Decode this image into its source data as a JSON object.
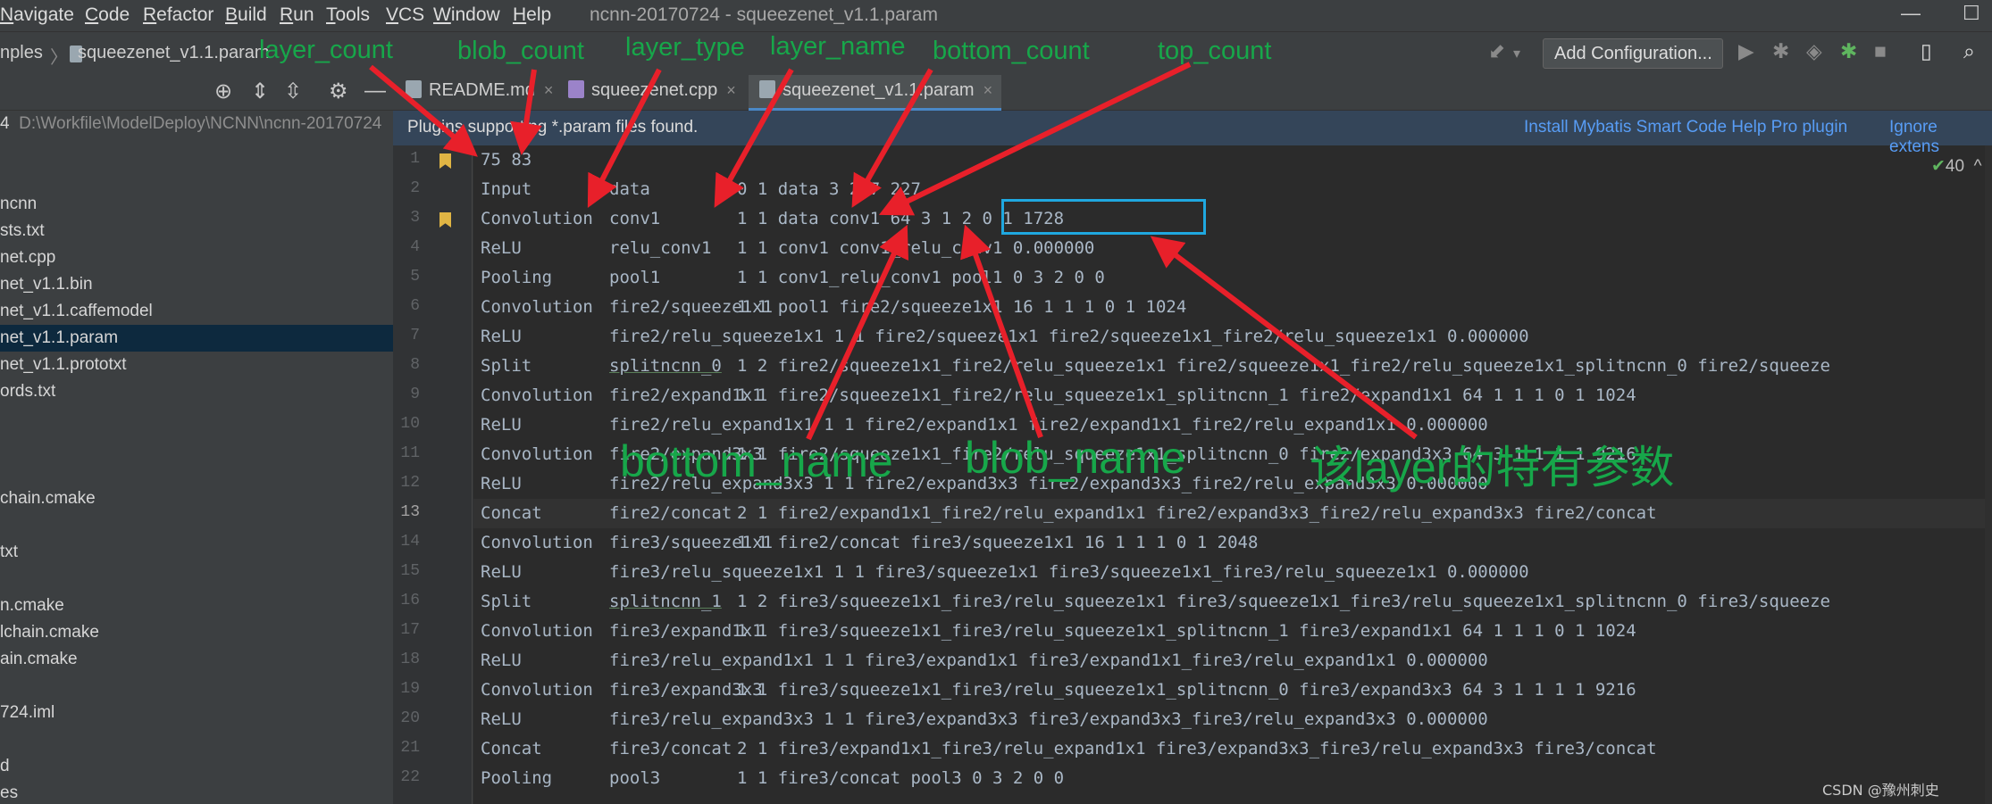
{
  "menu": {
    "items": [
      {
        "label": "Navigate",
        "mn": "N",
        "rest": "avigate"
      },
      {
        "label": "Code",
        "mn": "C",
        "rest": "ode"
      },
      {
        "label": "Refactor",
        "mn": "R",
        "rest": "efactor"
      },
      {
        "label": "Build",
        "mn": "B",
        "rest": "uild"
      },
      {
        "label": "Run",
        "mn": "R",
        "rest": "un"
      },
      {
        "label": "Tools",
        "mn": "T",
        "rest": "ools"
      },
      {
        "label": "VCS",
        "mn": "V",
        "rest": "CS"
      },
      {
        "label": "Window",
        "mn": "W",
        "rest": "indow"
      },
      {
        "label": "Help",
        "mn": "H",
        "rest": "elp"
      }
    ],
    "window_title": "ncnn-20170724 - squeezenet_v1.1.param",
    "minimize": "—",
    "maximize": "☐"
  },
  "toolbar": {
    "crumb_parent": "nples",
    "crumb_sep": "〉",
    "crumb_file": "squeezenet_v1.1.param",
    "add_config": "Add Configuration..."
  },
  "tabs": [
    {
      "label": "README.md",
      "close": "×"
    },
    {
      "label": "squeezenet.cpp",
      "close": "×"
    },
    {
      "label": "squeezenet_v1.1.param",
      "close": "×"
    }
  ],
  "sidebar": {
    "project_num": "4",
    "project_path": "D:\\Workfile\\ModelDeploy\\NCNN\\ncnn-20170724",
    "items": [
      {
        "label": "ncnn"
      },
      {
        "label": "sts.txt"
      },
      {
        "label": "net.cpp"
      },
      {
        "label": "net_v1.1.bin"
      },
      {
        "label": "net_v1.1.caffemodel"
      },
      {
        "label": "net_v1.1.param"
      },
      {
        "label": "net_v1.1.prototxt"
      },
      {
        "label": "ords.txt"
      },
      {
        "label": "chain.cmake"
      },
      {
        "label": "txt"
      },
      {
        "label": "n.cmake"
      },
      {
        "label": "lchain.cmake"
      },
      {
        "label": "ain.cmake"
      },
      {
        "label": "724.iml"
      },
      {
        "label": "d"
      },
      {
        "label": "es"
      }
    ]
  },
  "banner": {
    "message": "Plugins supporting *.param files found.",
    "install": "Install Mybatis Smart Code Help Pro plugin",
    "ignore": "Ignore extens"
  },
  "inspection": {
    "check": "✔",
    "count": "40",
    "caret": "^"
  },
  "code_lines": [
    {
      "n": "1",
      "type": "75 83",
      "name": "",
      "rest": ""
    },
    {
      "n": "2",
      "type": "Input",
      "name": "data",
      "rest": "0 1 data 3 227 227"
    },
    {
      "n": "3",
      "type": "Convolution",
      "name": "conv1",
      "rest": "1 1 data conv1 64 3 1 2 0 1 1728"
    },
    {
      "n": "4",
      "type": "ReLU",
      "name": "relu_conv1",
      "rest": "1 1 conv1 conv1_relu_conv1 0.000000"
    },
    {
      "n": "5",
      "type": "Pooling",
      "name": "pool1",
      "rest": "1 1 conv1_relu_conv1 pool1 0 3 2 0 0"
    },
    {
      "n": "6",
      "type": "Convolution",
      "name": "fire2/squeeze1x1",
      "rest": "1 1 pool1 fire2/squeeze1x1 16 1 1 1 0 1 1024"
    },
    {
      "n": "7",
      "type": "ReLU",
      "name": "fire2/relu_squeeze1x1 1 1 fire2/squeeze1x1 fire2/squeeze1x1_fire2/relu_squeeze1x1 0.000000",
      "rest": ""
    },
    {
      "n": "8",
      "type": "Split",
      "name": "splitncnn_0",
      "rest": "1 2 fire2/squeeze1x1_fire2/relu_squeeze1x1 fire2/squeeze1x1_fire2/relu_squeeze1x1_splitncnn_0 fire2/squeeze"
    },
    {
      "n": "9",
      "type": "Convolution",
      "name": "fire2/expand1x1",
      "rest": "1 1 fire2/squeeze1x1_fire2/relu_squeeze1x1_splitncnn_1 fire2/expand1x1 64 1 1 1 0 1 1024"
    },
    {
      "n": "10",
      "type": "ReLU",
      "name": "fire2/relu_expand1x1 1 1 fire2/expand1x1 fire2/expand1x1_fire2/relu_expand1x1 0.000000",
      "rest": ""
    },
    {
      "n": "11",
      "type": "Convolution",
      "name": "fire2/expand3x3",
      "rest": "1 1 fire2/squeeze1x1_fire2/relu_squeeze1x1_splitncnn_0 fire2/expand3x3 64 3 1 1 1 1 9216"
    },
    {
      "n": "12",
      "type": "ReLU",
      "name": "fire2/relu_expand3x3 1 1 fire2/expand3x3 fire2/expand3x3_fire2/relu_expand3x3 0.000000",
      "rest": ""
    },
    {
      "n": "13",
      "type": "Concat",
      "name": "fire2/concat",
      "rest": "2 1 fire2/expand1x1_fire2/relu_expand1x1 fire2/expand3x3_fire2/relu_expand3x3 fire2/concat"
    },
    {
      "n": "14",
      "type": "Convolution",
      "name": "fire3/squeeze1x1",
      "rest": "1 1 fire2/concat fire3/squeeze1x1 16 1 1 1 0 1 2048"
    },
    {
      "n": "15",
      "type": "ReLU",
      "name": "fire3/relu_squeeze1x1 1 1 fire3/squeeze1x1 fire3/squeeze1x1_fire3/relu_squeeze1x1 0.000000",
      "rest": ""
    },
    {
      "n": "16",
      "type": "Split",
      "name": "splitncnn_1",
      "rest": "1 2 fire3/squeeze1x1_fire3/relu_squeeze1x1 fire3/squeeze1x1_fire3/relu_squeeze1x1_splitncnn_0 fire3/squeeze"
    },
    {
      "n": "17",
      "type": "Convolution",
      "name": "fire3/expand1x1",
      "rest": "1 1 fire3/squeeze1x1_fire3/relu_squeeze1x1_splitncnn_1 fire3/expand1x1 64 1 1 1 0 1 1024"
    },
    {
      "n": "18",
      "type": "ReLU",
      "name": "fire3/relu_expand1x1 1 1 fire3/expand1x1 fire3/expand1x1_fire3/relu_expand1x1 0.000000",
      "rest": ""
    },
    {
      "n": "19",
      "type": "Convolution",
      "name": "fire3/expand3x3",
      "rest": "1 1 fire3/squeeze1x1_fire3/relu_squeeze1x1_splitncnn_0 fire3/expand3x3 64 3 1 1 1 1 9216"
    },
    {
      "n": "20",
      "type": "ReLU",
      "name": "fire3/relu_expand3x3 1 1 fire3/expand3x3 fire3/expand3x3_fire3/relu_expand3x3 0.000000",
      "rest": ""
    },
    {
      "n": "21",
      "type": "Concat",
      "name": "fire3/concat",
      "rest": "2 1 fire3/expand1x1_fire3/relu_expand1x1 fire3/expand3x3_fire3/relu_expand3x3 fire3/concat"
    },
    {
      "n": "22",
      "type": "Pooling",
      "name": "pool3",
      "rest": "1 1 fire3/concat pool3 0 3 2 0 0"
    }
  ],
  "annotations": {
    "layer_count": "layer_count",
    "blob_count": "blob_count",
    "layer_type": "layer_type",
    "layer_name": "layer_name",
    "bottom_count": "bottom_count",
    "top_count": "top_count",
    "bottom_name": "bottom_name",
    "blob_name": "blob_name",
    "layer_params": "该layer的特有参数",
    "color": "#17a74a",
    "arrow_color": "#e8202a",
    "box_color": "#1fa8e0"
  },
  "watermark": "CSDN @豫州刺史"
}
